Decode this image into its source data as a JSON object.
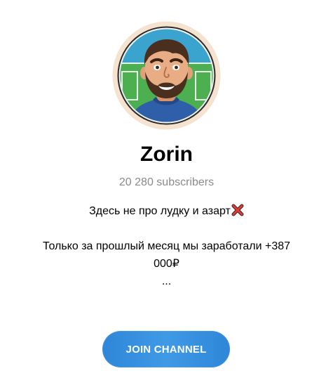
{
  "channel": {
    "name": "Zorin",
    "subscribers": "20 280 subscribers"
  },
  "description": {
    "line1": "Здесь не про лудку и азарт",
    "line1_emoji": "cross-mark-icon",
    "line2": "Только за прошлый месяц мы заработали +387",
    "line3": "000₽",
    "line4": "..."
  },
  "join_button": {
    "label": "JOIN CHANNEL"
  },
  "colors": {
    "accent": "#2f86d8",
    "subscribers_text": "#8a8a8a",
    "avatar_ring": "#f6e3cf",
    "avatar_field": "#3aa4cf"
  }
}
